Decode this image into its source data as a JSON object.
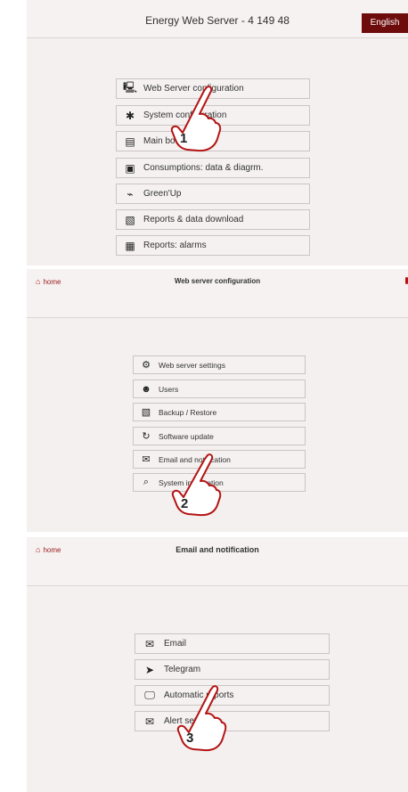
{
  "panel1": {
    "title": "Energy Web Server - 4 149 48",
    "language": "English",
    "items": [
      {
        "label": "Web Server configuration",
        "icon": "monitor-gear-icon"
      },
      {
        "label": "System configuration",
        "icon": "gears-icon"
      },
      {
        "label": "Main board",
        "icon": "board-icon"
      },
      {
        "label": "Consumptions: data & diagrm.",
        "icon": "chart-icon"
      },
      {
        "label": "Green'Up",
        "icon": "car-icon"
      },
      {
        "label": "Reports & data download",
        "icon": "report-icon"
      },
      {
        "label": "Reports: alarms",
        "icon": "alarm-report-icon"
      }
    ],
    "step": "1"
  },
  "panel2": {
    "home": "home",
    "title": "Web server configuration",
    "items": [
      {
        "label": "Web server settings",
        "icon": "gear-icon"
      },
      {
        "label": "Users",
        "icon": "users-icon"
      },
      {
        "label": "Backup / Restore",
        "icon": "backup-icon"
      },
      {
        "label": "Software update",
        "icon": "update-icon"
      },
      {
        "label": "Email and notification",
        "icon": "mail-clock-icon"
      },
      {
        "label": "System information",
        "icon": "search-icon"
      }
    ],
    "step": "2"
  },
  "panel3": {
    "home": "home",
    "title": "Email and notification",
    "items": [
      {
        "label": "Email",
        "icon": "envelope-icon"
      },
      {
        "label": "Telegram",
        "icon": "telegram-icon"
      },
      {
        "label": "Automatic reports",
        "icon": "monitor-report-icon"
      },
      {
        "label": "Alert settings",
        "icon": "mail-gear-icon"
      }
    ],
    "step": "3"
  }
}
